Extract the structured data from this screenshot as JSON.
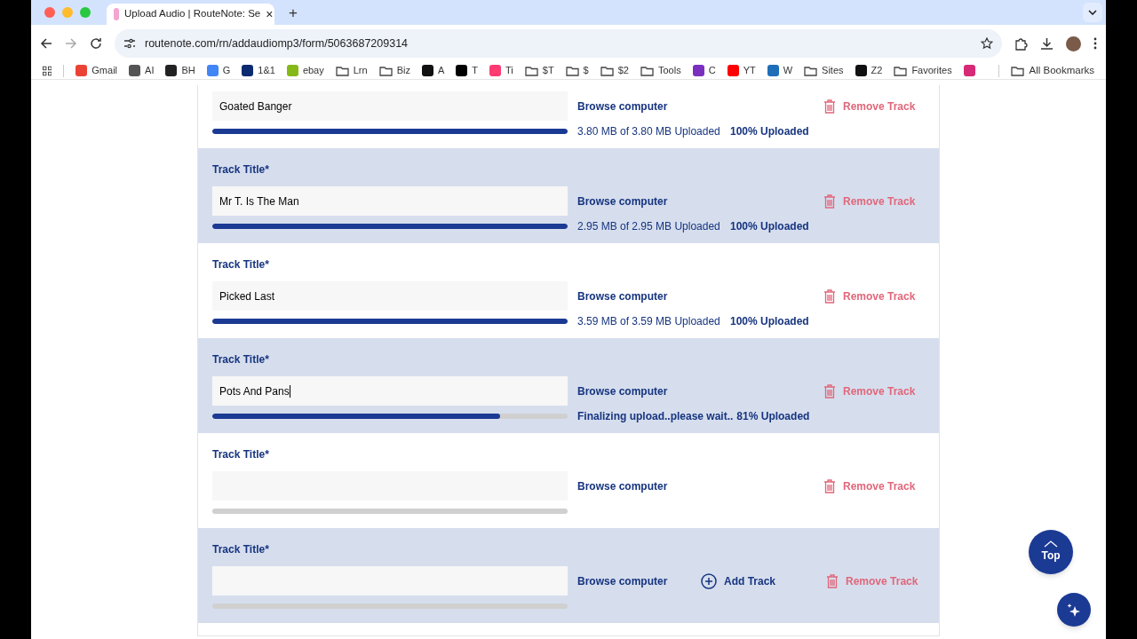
{
  "tab": {
    "title": "Upload Audio | RouteNote: Se",
    "close": "×",
    "new_tab": "+"
  },
  "address": {
    "url": "routenote.com/rn/addaudiomp3/form/5063687209314"
  },
  "bookmarks": [
    {
      "label": "Gmail",
      "kind": "site",
      "color": "#ea4335"
    },
    {
      "label": "AI",
      "kind": "site",
      "color": "#555555"
    },
    {
      "label": "BH",
      "kind": "site",
      "color": "#222222"
    },
    {
      "label": "G",
      "kind": "site",
      "color": "#4285f4"
    },
    {
      "label": "1&1",
      "kind": "site",
      "color": "#0b2a6f"
    },
    {
      "label": "ebay",
      "kind": "site",
      "color": "#86b817"
    },
    {
      "label": "Lrn",
      "kind": "folder"
    },
    {
      "label": "Biz",
      "kind": "folder"
    },
    {
      "label": "A",
      "kind": "site",
      "color": "#111111"
    },
    {
      "label": "T",
      "kind": "site",
      "color": "#000000"
    },
    {
      "label": "Ti",
      "kind": "site",
      "color": "#fe3c72"
    },
    {
      "label": "$T",
      "kind": "folder"
    },
    {
      "label": "$",
      "kind": "folder"
    },
    {
      "label": "$2",
      "kind": "folder"
    },
    {
      "label": "Tools",
      "kind": "folder"
    },
    {
      "label": "C",
      "kind": "site",
      "color": "#7b2fbe"
    },
    {
      "label": "YT",
      "kind": "site",
      "color": "#ff0000"
    },
    {
      "label": "W",
      "kind": "site",
      "color": "#1e6fb8"
    },
    {
      "label": "Sites",
      "kind": "folder"
    },
    {
      "label": "Z2",
      "kind": "site",
      "color": "#111111"
    },
    {
      "label": "Favorites",
      "kind": "folder"
    },
    {
      "kind": "site",
      "color": "#d62976"
    }
  ],
  "all_bookmarks": "All Bookmarks",
  "tracks": [
    {
      "title": "Goated Banger",
      "browse": "Browse computer",
      "remove": "Remove Track",
      "level": 1,
      "size": "3.80 MB of 3.80 MB Uploaded",
      "percent": "100% Uploaded",
      "kind": "uploaded"
    },
    {
      "label": "Track Title*",
      "title": "Mr T. Is The Man",
      "browse": "Browse computer",
      "remove": "Remove Track",
      "level": 1,
      "size": "2.95 MB of 2.95 MB Uploaded",
      "percent": "100% Uploaded",
      "kind": "uploaded"
    },
    {
      "label": "Track Title*",
      "title": "Picked Last",
      "browse": "Browse computer",
      "remove": "Remove Track",
      "level": 1,
      "size": "3.59 MB of 3.59 MB Uploaded",
      "percent": "100% Uploaded",
      "kind": "uploaded"
    },
    {
      "label": "Track Title*",
      "title": "Pots And Pans",
      "browse": "Browse computer",
      "remove": "Remove Track",
      "level": 0.81,
      "size": "Finalizing upload..please wait..",
      "percent": "81% Uploaded",
      "kind": "finalizing"
    },
    {
      "label": "Track Title*",
      "browse": "Browse computer",
      "remove": "Remove Track",
      "level": 0,
      "kind": "empty"
    },
    {
      "label": "Track Title*",
      "browse": "Browse computer",
      "add": "Add Track",
      "remove": "Remove Track",
      "level": 0,
      "kind": "empty"
    }
  ],
  "top_button": "Top"
}
